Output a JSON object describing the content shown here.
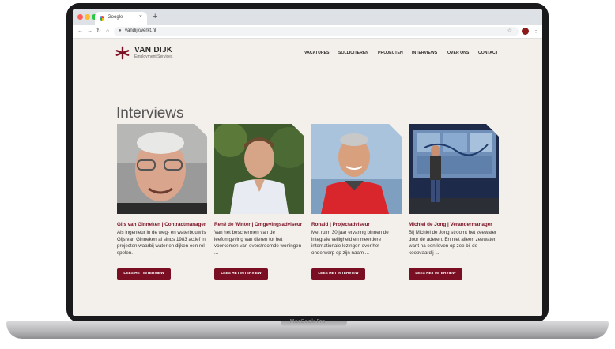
{
  "device": {
    "label": "MacBook Pro"
  },
  "browser": {
    "tab_title": "Google",
    "tab_close": "×",
    "new_tab": "+",
    "url": "vandijkwerkt.nl",
    "icons": [
      "back-icon",
      "forward-icon",
      "reload-icon",
      "home-icon",
      "lock-icon",
      "star-icon",
      "profile-icon",
      "menu-icon"
    ],
    "traffic_lights": [
      "#ff5f57",
      "#febc2e",
      "#28c840"
    ]
  },
  "site": {
    "logo": {
      "name": "VAN DIJK",
      "subtitle": "Employment Services",
      "mark_color": "#7a0e22"
    },
    "nav": [
      "VACATURES",
      "SOLLICITEREN",
      "PROJECTEN",
      "INTERVIEWS",
      "OVER ONS",
      "CONTACT"
    ],
    "page_title": "Interviews",
    "accent": "#7a0e22",
    "cards": [
      {
        "name": "Gijs van Ginneken  |  Contractmanager",
        "description": "Als ingenieur in de weg- en waterbouw is Gijs van Ginneken al sinds 1983 actief in projecten waarbij water en dijken een rol spelen.",
        "button": "LEES HET INTERVIEW"
      },
      {
        "name": "René de Winter  |  Omgevingsadviseur",
        "description": "Van het beschermen van de leefomgeving van dieren tot het voorkomen van overstroomde woningen ...",
        "button": "LEES HET INTERVIEW"
      },
      {
        "name": "Ronald  |  Projectadviseur",
        "description": "Met ruim 30 jaar ervaring binnen de integrale veiligheid en meerdere internationale lezingen over het onderwerp op zijn naam ...",
        "button": "LEES HET INTERVIEW"
      },
      {
        "name": "Michiel de Jong  |  Verandermanager",
        "description": "Bij Michiel de Jong stroomt het zeewater door de aderen. En niet alleen zeewater, want na een leven op zee bij de koopvaardij ...",
        "button": "LEES HET INTERVIEW"
      }
    ]
  }
}
